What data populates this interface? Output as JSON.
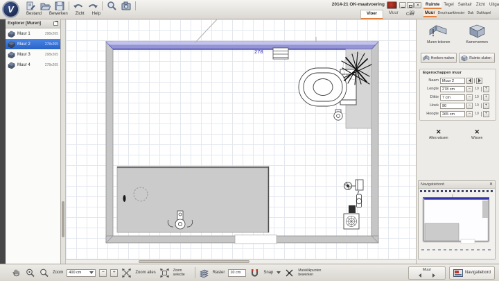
{
  "window": {
    "logo_text": "V",
    "title": "2014-21 OK-maatvoering",
    "cad_label": "Cad",
    "menus": [
      "Bestand",
      "Bewerken",
      "Zicht",
      "Help"
    ]
  },
  "view_tabs": {
    "items": [
      "Vloer",
      "Muur",
      "3D"
    ],
    "active": "Vloer"
  },
  "ribbon": {
    "tabs": [
      "Ruimte",
      "Tegel",
      "Sanitair",
      "Zicht",
      "Uitgave"
    ],
    "active_tab": "Ruimte",
    "subtabs": [
      "Muur",
      "Deur/raam",
      "Venster",
      "Dak",
      "Dakkapel"
    ],
    "active_subtab": "Muur"
  },
  "explorer": {
    "title": "Explorer [Muren]",
    "items": [
      {
        "name": "Muur 1",
        "dims": "298x265"
      },
      {
        "name": "Muur 2",
        "dims": "278x265"
      },
      {
        "name": "Muur 3",
        "dims": "298x265"
      },
      {
        "name": "Muur 4",
        "dims": "278x265"
      }
    ],
    "selected": "Muur 2"
  },
  "tools": {
    "draw_walls": "Muren tekenen",
    "room_shapes": "Kamervormen",
    "make_corners": "Hoeken maken",
    "close_room": "Ruimte sluiten",
    "properties_title": "Eigenschappen muur",
    "fields": [
      {
        "label": "Naam",
        "value": "Muur 2"
      },
      {
        "label": "Lengte",
        "value": "278 cm",
        "step": "10"
      },
      {
        "label": "Dikte",
        "value": "7 cm",
        "step": "10"
      },
      {
        "label": "Hoek",
        "value": "90",
        "step": "10"
      },
      {
        "label": "Hoogte",
        "value": "265 cm",
        "step": "10"
      }
    ],
    "clear_all": "Alles wissen",
    "delete": "Wissen"
  },
  "navigator": {
    "title": "Navigatiebord"
  },
  "canvas": {
    "dimension_label": "278"
  },
  "statusbar": {
    "zoom_label": "Zoom",
    "zoom_value": "400 cm",
    "zoom_all": "Zoom alles",
    "zoom_selection": "Zoom selectie",
    "raster_label": "Raster",
    "raster_value": "10 cm",
    "snap_label": "Snap",
    "edit_points": "Muisklikpunten bewerken",
    "wall_nav_label": "Muur",
    "navigator_toggle": "Navigatiebord"
  },
  "symbols": {
    "minus": "−",
    "plus": "+",
    "close": "✕",
    "divider": "|"
  },
  "colors": {
    "accent_orange": "#e0813f",
    "selection_blue": "#2f6fd6",
    "wall_selected": "#9595d5",
    "wall_gray": "#c6c6c6"
  }
}
